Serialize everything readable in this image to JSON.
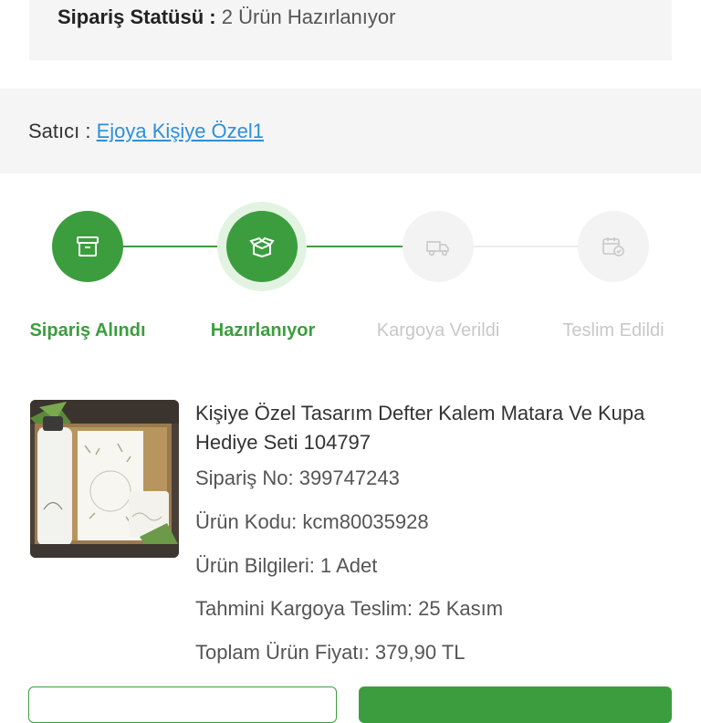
{
  "order_status": {
    "label": "Sipariş Statüsü :",
    "value": "2 Ürün Hazırlanıyor"
  },
  "seller": {
    "label": "Satıcı :",
    "name": "Ejoya Kişiye Özel1"
  },
  "steps": [
    {
      "label": "Sipariş Alındı",
      "state": "done",
      "icon": "archive-box-icon"
    },
    {
      "label": "Hazırlanıyor",
      "state": "current",
      "icon": "open-box-icon"
    },
    {
      "label": "Kargoya Verildi",
      "state": "pending",
      "icon": "truck-icon"
    },
    {
      "label": "Teslim Edildi",
      "state": "pending",
      "icon": "delivered-calendar-icon"
    }
  ],
  "product": {
    "title": "Kişiye Özel Tasarım Defter Kalem Matara Ve Kupa Hediye Seti 104797",
    "order_no": "Sipariş No: 399747243",
    "product_code": "Ürün Kodu: kcm80035928",
    "product_info": "Ürün Bilgileri: 1 Adet",
    "estimated_shipping": "Tahmini Kargoya Teslim: 25 Kasım",
    "total_price": "Toplam Ürün Fiyatı: 379,90 TL"
  },
  "colors": {
    "accent_green": "#3c9d3e",
    "link_blue": "#2f8fd8",
    "inactive_gray": "#c8c8c8",
    "panel_bg": "#f5f5f5"
  }
}
